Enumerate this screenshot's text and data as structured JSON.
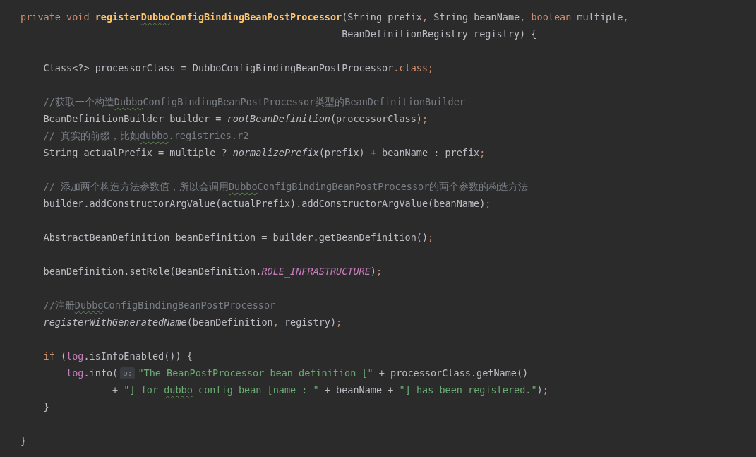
{
  "editor": {
    "lines": [
      {
        "kind": "code",
        "tokens": [
          {
            "kind": "keyword",
            "text": "private void "
          },
          {
            "kind": "decl",
            "text": "register"
          },
          {
            "kind": "decl",
            "text": "Dubbo",
            "typo": true
          },
          {
            "kind": "decl",
            "text": "ConfigBindingBeanPostProcessor"
          },
          {
            "kind": "text",
            "text": "(String prefix"
          },
          {
            "kind": "keyword",
            "text": ", "
          },
          {
            "kind": "text",
            "text": "String beanName"
          },
          {
            "kind": "keyword",
            "text": ", boolean "
          },
          {
            "kind": "text",
            "text": "multiple"
          },
          {
            "kind": "keyword",
            "text": ","
          }
        ]
      },
      {
        "kind": "code",
        "tokens": [
          {
            "kind": "text",
            "text": "                                                        BeanDefinitionRegistry registry) {"
          }
        ]
      },
      {
        "kind": "blank"
      },
      {
        "kind": "code",
        "tokens": [
          {
            "kind": "text",
            "text": "    Class<?> processorClass = DubboConfigBindingBeanPostProcessor"
          },
          {
            "kind": "keyword",
            "text": ".class;"
          }
        ]
      },
      {
        "kind": "blank"
      },
      {
        "kind": "code",
        "tokens": [
          {
            "kind": "comment",
            "text": "    //获取一个构造"
          },
          {
            "kind": "comment",
            "text": "Dubbo",
            "typo": true
          },
          {
            "kind": "comment",
            "text": "ConfigBindingBeanPostProcessor类型的BeanDefinitionBuilder"
          }
        ]
      },
      {
        "kind": "code",
        "tokens": [
          {
            "kind": "text",
            "text": "    BeanDefinitionBuilder builder = "
          },
          {
            "kind": "static",
            "text": "rootBeanDefinition"
          },
          {
            "kind": "text",
            "text": "(processorClass)"
          },
          {
            "kind": "keyword",
            "text": ";"
          }
        ]
      },
      {
        "kind": "code",
        "tokens": [
          {
            "kind": "comment",
            "text": "    // 真实的前缀，比如"
          },
          {
            "kind": "comment",
            "text": "dubbo",
            "typo": true
          },
          {
            "kind": "comment",
            "text": ".registries.r2"
          }
        ]
      },
      {
        "kind": "code",
        "tokens": [
          {
            "kind": "text",
            "text": "    String actualPrefix = multiple ? "
          },
          {
            "kind": "static",
            "text": "normalizePrefix"
          },
          {
            "kind": "text",
            "text": "(prefix) + beanName : prefix"
          },
          {
            "kind": "keyword",
            "text": ";"
          }
        ]
      },
      {
        "kind": "blank"
      },
      {
        "kind": "code",
        "tokens": [
          {
            "kind": "comment",
            "text": "    // 添加两个构造方法参数值，所以会调用"
          },
          {
            "kind": "comment",
            "text": "Dubbo",
            "typo": true
          },
          {
            "kind": "comment",
            "text": "ConfigBindingBeanPostProcessor的两个参数的构造方法"
          }
        ]
      },
      {
        "kind": "code",
        "tokens": [
          {
            "kind": "text",
            "text": "    builder.addConstructorArgValue(actualPrefix).addConstructorArgValue(beanName)"
          },
          {
            "kind": "keyword",
            "text": ";"
          }
        ]
      },
      {
        "kind": "blank"
      },
      {
        "kind": "code",
        "tokens": [
          {
            "kind": "text",
            "text": "    AbstractBeanDefinition beanDefinition = builder.getBeanDefinition()"
          },
          {
            "kind": "keyword",
            "text": ";"
          }
        ]
      },
      {
        "kind": "blank"
      },
      {
        "kind": "code",
        "tokens": [
          {
            "kind": "text",
            "text": "    beanDefinition.setRole(BeanDefinition."
          },
          {
            "kind": "constant",
            "text": "ROLE_INFRASTRUCTURE"
          },
          {
            "kind": "text",
            "text": ")"
          },
          {
            "kind": "keyword",
            "text": ";"
          }
        ]
      },
      {
        "kind": "blank"
      },
      {
        "kind": "code",
        "tokens": [
          {
            "kind": "comment",
            "text": "    //注册"
          },
          {
            "kind": "comment",
            "text": "Dubbo",
            "typo": true
          },
          {
            "kind": "comment",
            "text": "ConfigBindingBeanPostProcessor"
          }
        ]
      },
      {
        "kind": "code",
        "tokens": [
          {
            "kind": "static",
            "text": "    registerWithGeneratedName"
          },
          {
            "kind": "text",
            "text": "(beanDefinition"
          },
          {
            "kind": "keyword",
            "text": ", "
          },
          {
            "kind": "text",
            "text": "registry)"
          },
          {
            "kind": "keyword",
            "text": ";"
          }
        ]
      },
      {
        "kind": "blank"
      },
      {
        "kind": "code",
        "tokens": [
          {
            "kind": "keyword",
            "text": "    if "
          },
          {
            "kind": "text",
            "text": "("
          },
          {
            "kind": "field",
            "text": "log"
          },
          {
            "kind": "text",
            "text": ".isInfoEnabled()) {"
          }
        ]
      },
      {
        "kind": "code",
        "tokens": [
          {
            "kind": "field",
            "text": "        log"
          },
          {
            "kind": "text",
            "text": ".info("
          },
          {
            "kind": "hint",
            "text": "o:"
          },
          {
            "kind": "string",
            "text": "\"The BeanPostProcessor bean definition [\""
          },
          {
            "kind": "text",
            "text": " + processorClass.getName()"
          }
        ]
      },
      {
        "kind": "code",
        "tokens": [
          {
            "kind": "text",
            "text": "                + "
          },
          {
            "kind": "string",
            "text": "\"] for "
          },
          {
            "kind": "string",
            "text": "dubbo",
            "typo": true
          },
          {
            "kind": "string",
            "text": " config bean [name : \""
          },
          {
            "kind": "text",
            "text": " + beanName + "
          },
          {
            "kind": "string",
            "text": "\"] has been registered.\""
          },
          {
            "kind": "text",
            "text": ")"
          },
          {
            "kind": "keyword",
            "text": ";"
          }
        ]
      },
      {
        "kind": "code",
        "tokens": [
          {
            "kind": "text",
            "text": "    }"
          }
        ]
      },
      {
        "kind": "blank"
      },
      {
        "kind": "code",
        "tokens": [
          {
            "kind": "text",
            "text": "}"
          }
        ]
      }
    ]
  }
}
